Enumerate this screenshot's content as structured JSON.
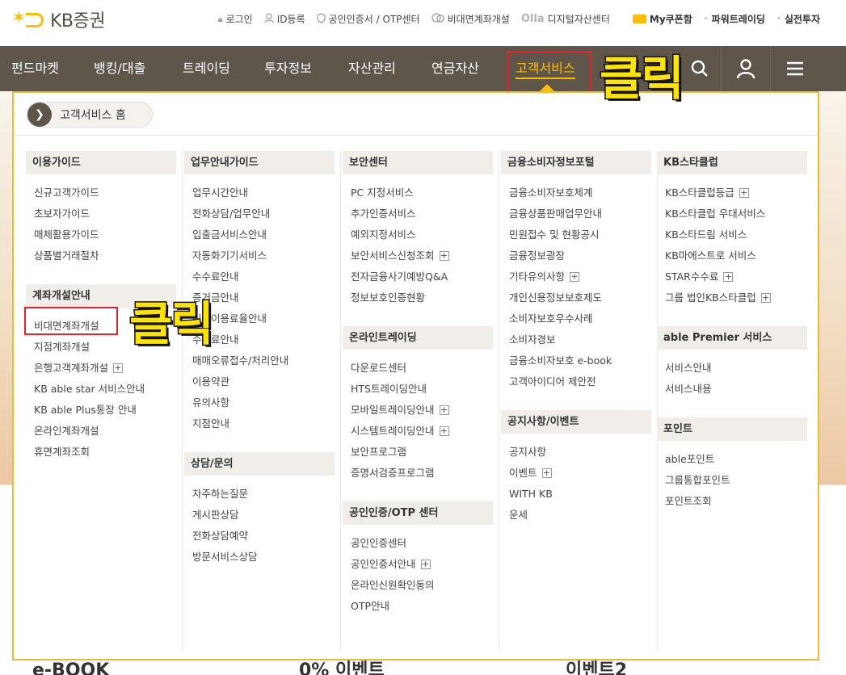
{
  "brand": {
    "name": "KB증권"
  },
  "util_links": [
    {
      "label": "로그인",
      "icon": "lock-icon"
    },
    {
      "label": "ID등록",
      "icon": "user-icon"
    },
    {
      "label": "공인인증서 / OTP센터",
      "icon": "shield-icon"
    },
    {
      "label": "비대면계좌개설",
      "icon": "chat-icon"
    },
    {
      "prefix": "Olla",
      "label": "디지털자산센터"
    },
    {
      "label": "My쿠폰함",
      "icon": "coupon-icon"
    },
    {
      "label": "파워트레이딩"
    },
    {
      "label": "실전투자"
    }
  ],
  "gnb": [
    {
      "label": "펀드마켓"
    },
    {
      "label": "뱅킹/대출"
    },
    {
      "label": "트레이딩"
    },
    {
      "label": "투자정보"
    },
    {
      "label": "자산관리"
    },
    {
      "label": "연금자산"
    },
    {
      "label": "고객서비스",
      "active": true
    }
  ],
  "panel": {
    "home_label": "고객서비스 홈",
    "columns": [
      {
        "groups": [
          {
            "title": "이용가이드",
            "items": [
              {
                "label": "신규고객가이드"
              },
              {
                "label": "초보자가이드"
              },
              {
                "label": "매체활용가이드"
              },
              {
                "label": "상품별거래절차"
              }
            ]
          },
          {
            "title": "계좌개설안내",
            "items": [
              {
                "label": "비대면계좌개설"
              },
              {
                "label": "지점계좌개설"
              },
              {
                "label": "은행고객계좌개설",
                "plus": true
              },
              {
                "label": "KB able star 서비스안내"
              },
              {
                "label": "KB able Plus통장 안내"
              },
              {
                "label": "온라인계좌개설"
              },
              {
                "label": "휴면계좌조회"
              }
            ]
          }
        ]
      },
      {
        "groups": [
          {
            "title": "업무안내가이드",
            "items": [
              {
                "label": "업무시간안내"
              },
              {
                "label": "전화상담/업무안내"
              },
              {
                "label": "입출금서비스안내"
              },
              {
                "label": "자동화기기서비스"
              },
              {
                "label": "수수료안내"
              },
              {
                "label": "증거금안내"
              },
              {
                "label": "신용이용료율안내"
              },
              {
                "label": "수수료안내"
              },
              {
                "label": "매매오류접수/처리안내"
              },
              {
                "label": "이용약관"
              },
              {
                "label": "유의사항"
              },
              {
                "label": "지점안내"
              }
            ]
          },
          {
            "title": "상담/문의",
            "items": [
              {
                "label": "자주하는질문"
              },
              {
                "label": "게시판상담"
              },
              {
                "label": "전화상담예약"
              },
              {
                "label": "방문서비스상담"
              }
            ]
          }
        ]
      },
      {
        "groups": [
          {
            "title": "보안센터",
            "items": [
              {
                "label": "PC 지정서비스"
              },
              {
                "label": "추가인증서비스"
              },
              {
                "label": "예외지정서비스"
              },
              {
                "label": "보안서비스신청조회",
                "plus": true
              },
              {
                "label": "전자금융사기예방Q&A"
              },
              {
                "label": "정보보호인증현황"
              }
            ]
          },
          {
            "title": "온라인트레이딩",
            "items": [
              {
                "label": "다운로드센터"
              },
              {
                "label": "HTS트레이딩안내"
              },
              {
                "label": "모바일트레이딩안내",
                "plus": true
              },
              {
                "label": "시스템트레이딩안내",
                "plus": true
              },
              {
                "label": "보안프로그램"
              },
              {
                "label": "증명서검증프로그램"
              }
            ]
          },
          {
            "title": "공인인증/OTP 센터",
            "items": [
              {
                "label": "공인인증센터"
              },
              {
                "label": "공인인증서안내",
                "plus": true
              },
              {
                "label": "온라인신원확인동의"
              },
              {
                "label": "OTP안내"
              }
            ]
          }
        ]
      },
      {
        "groups": [
          {
            "title": "금융소비자정보포털",
            "items": [
              {
                "label": "금융소비자보호체계"
              },
              {
                "label": "금융상품판매업무안내"
              },
              {
                "label": "민원접수 및 현황공시"
              },
              {
                "label": "금융정보광장"
              },
              {
                "label": "기타유의사항",
                "plus": true
              },
              {
                "label": "개인신용정보보호제도"
              },
              {
                "label": "소비자보호우수사례"
              },
              {
                "label": "소비자경보"
              },
              {
                "label": "금융소비자보호 e-book"
              },
              {
                "label": "고객아이디어 제안전"
              }
            ]
          },
          {
            "title": "공지사항/이벤트",
            "items": [
              {
                "label": "공지사항"
              },
              {
                "label": "이벤트",
                "plus": true
              },
              {
                "label": "WITH KB"
              },
              {
                "label": "운세"
              }
            ]
          }
        ]
      },
      {
        "groups": [
          {
            "title": "KB스타클럽",
            "items": [
              {
                "label": "KB스타클럽등급",
                "plus": true
              },
              {
                "label": "KB스타클럽 우대서비스"
              },
              {
                "label": "KB스타드림 서비스"
              },
              {
                "label": "KB마에스트로 서비스"
              },
              {
                "label": "STAR수수료",
                "plus": true
              },
              {
                "label": "그룹 법인KB스타클럽",
                "plus": true
              }
            ]
          },
          {
            "title": "able Premier 서비스",
            "items": [
              {
                "label": "서비스안내"
              },
              {
                "label": "서비스내용"
              }
            ]
          },
          {
            "title": "포인트",
            "items": [
              {
                "label": "able포인트"
              },
              {
                "label": "그룹통합포인트"
              },
              {
                "label": "포인트조회"
              }
            ]
          }
        ]
      }
    ]
  },
  "callouts": {
    "nav_click": "클릭",
    "menu_click": "클릭"
  },
  "bottom_peek": [
    "e-BOOK",
    "0% 이벤트",
    "이벤트2"
  ],
  "colors": {
    "nav_bg": "#5e554b",
    "accent": "#ffbc00",
    "highlight_box": "#e8202a",
    "callout": "#ffe400"
  }
}
